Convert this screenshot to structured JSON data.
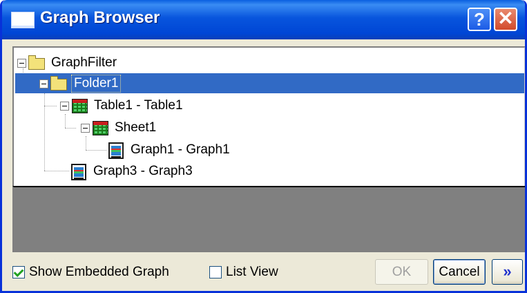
{
  "window": {
    "title": "Graph Browser",
    "help_label": "?",
    "close_label": "✕"
  },
  "tree": {
    "nodes": [
      {
        "label": "GraphFilter",
        "icon": "folder-icon"
      },
      {
        "label": "Folder1",
        "icon": "folder-icon",
        "selected": true
      },
      {
        "label": "Table1 - Table1",
        "icon": "table-icon"
      },
      {
        "label": "Sheet1",
        "icon": "table-icon"
      },
      {
        "label": "Graph1 - Graph1",
        "icon": "graph-icon"
      },
      {
        "label": "Graph3 - Graph3",
        "icon": "graph-icon"
      }
    ]
  },
  "options": {
    "show_embedded_label": "Show Embedded Graph",
    "show_embedded_checked": true,
    "list_view_label": "List View",
    "list_view_checked": false
  },
  "buttons": {
    "ok_label": "OK",
    "cancel_label": "Cancel",
    "more_label": "»"
  },
  "colors": {
    "titlebar": "#0054e3",
    "selection": "#316ac5",
    "dialog_bg": "#ece9d8"
  }
}
